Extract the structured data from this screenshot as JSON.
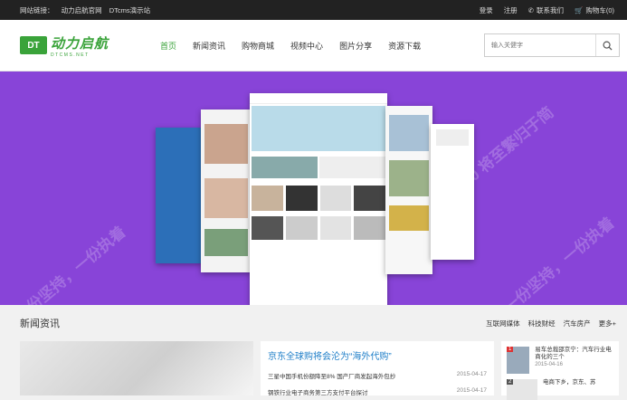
{
  "topbar": {
    "label": "网站链接：",
    "links": [
      "动力启航官网",
      "DTcms演示站"
    ],
    "login": "登录",
    "register": "注册",
    "contact": "联系我们",
    "cart": "购物车(0)"
  },
  "header": {
    "logo_badge": "DT",
    "logo_cn": "动力启航",
    "logo_en": "DTCMS.NET",
    "nav": [
      "首页",
      "新闻资讯",
      "购物商城",
      "视频中心",
      "图片分享",
      "资源下载"
    ],
    "search_placeholder": "输入关健字"
  },
  "banner": {
    "watermark": "DTcms 5.0 将至繁归于简",
    "watermark2": "一份坚持，一份执着"
  },
  "news_section": {
    "title": "新闻资讯",
    "tabs": [
      "互联网媒体",
      "科技财经",
      "汽车房产",
      "更多+"
    ],
    "headline": "京东全球购将会沦为“海外代购”",
    "rows": [
      {
        "title": "三星中国手机份额降至8% 国产厂商发起海外包抄",
        "date": "2015-04-17"
      },
      {
        "title": "钢铁行业电子商务第三方支付平台探讨",
        "date": "2015-04-17"
      }
    ],
    "rank": [
      {
        "num": "1",
        "title": "易车总裁邵京宁：汽车行业电商化的三个",
        "date": "2015-04-16"
      },
      {
        "num": "2",
        "title": "电商下乡，京东、苏",
        "date": ""
      }
    ]
  }
}
